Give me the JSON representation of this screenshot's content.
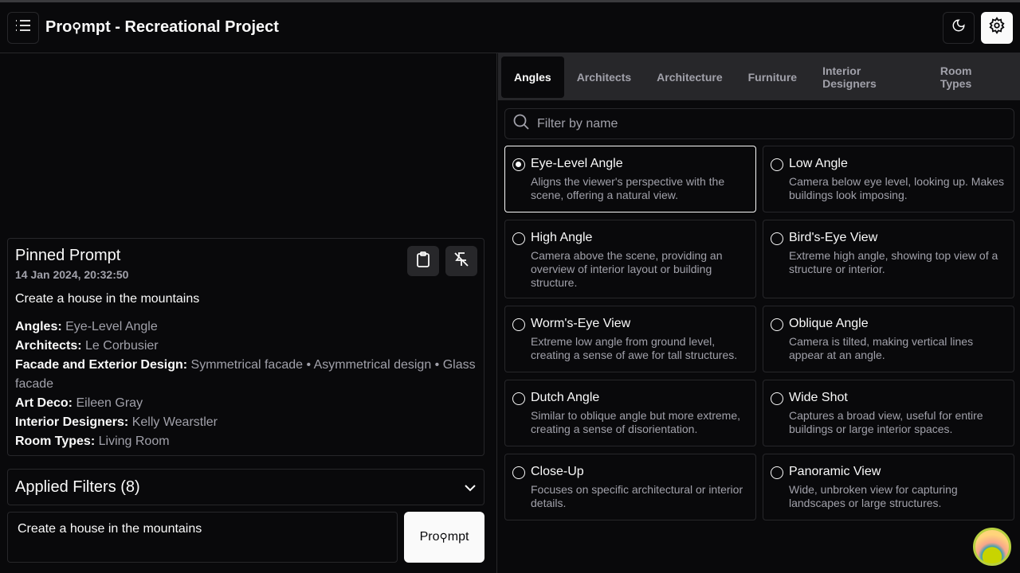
{
  "header": {
    "title": "Pro⁇mpt - Recreational Project",
    "title_parts": [
      "Pro",
      "mpt - Recreational Project"
    ],
    "menu_icon": "list-icon",
    "theme_icon": "moon-icon",
    "settings_icon": "gear-icon"
  },
  "pinned": {
    "title": "Pinned Prompt",
    "date": "14 Jan 2024, 20:32:50",
    "text": "Create a house in the mountains",
    "attributes": [
      {
        "label": "Angles:",
        "value": "Eye-Level Angle"
      },
      {
        "label": "Architects:",
        "value": "Le Corbusier"
      },
      {
        "label": "Facade and Exterior Design:",
        "value": "Symmetrical facade • Asymmetrical design • Glass facade"
      },
      {
        "label": "Art Deco:",
        "value": "Eileen Gray"
      },
      {
        "label": "Interior Designers:",
        "value": "Kelly Wearstler"
      },
      {
        "label": "Room Types:",
        "value": "Living Room"
      }
    ]
  },
  "applied": {
    "label": "Applied Filters (8)"
  },
  "prompt_input": {
    "value": "Create a house in the mountains"
  },
  "prompt_button": {
    "label_a": "Pro",
    "label_b": "mpt"
  },
  "tabs": [
    "Angles",
    "Architects",
    "Architecture",
    "Furniture",
    "Interior Designers",
    "Room Types"
  ],
  "filter": {
    "placeholder": "Filter by name"
  },
  "options": [
    {
      "name": "Eye-Level Angle",
      "desc": "Aligns the viewer's perspective with the scene, offering a natural view."
    },
    {
      "name": "Low Angle",
      "desc": "Camera below eye level, looking up. Makes buildings look imposing."
    },
    {
      "name": "High Angle",
      "desc": "Camera above the scene, providing an overview of interior layout or building structure."
    },
    {
      "name": "Bird's-Eye View",
      "desc": "Extreme high angle, showing top view of a structure or interior."
    },
    {
      "name": "Worm's-Eye View",
      "desc": "Extreme low angle from ground level, creating a sense of awe for tall structures."
    },
    {
      "name": "Oblique Angle",
      "desc": "Camera is tilted, making vertical lines appear at an angle."
    },
    {
      "name": "Dutch Angle",
      "desc": "Similar to oblique angle but more extreme, creating a sense of disorientation."
    },
    {
      "name": "Wide Shot",
      "desc": "Captures a broad view, useful for entire buildings or large interior spaces."
    },
    {
      "name": "Close-Up",
      "desc": "Focuses on specific architectural or interior details."
    },
    {
      "name": "Panoramic View",
      "desc": "Wide, unbroken view for capturing landscapes or large structures."
    }
  ]
}
